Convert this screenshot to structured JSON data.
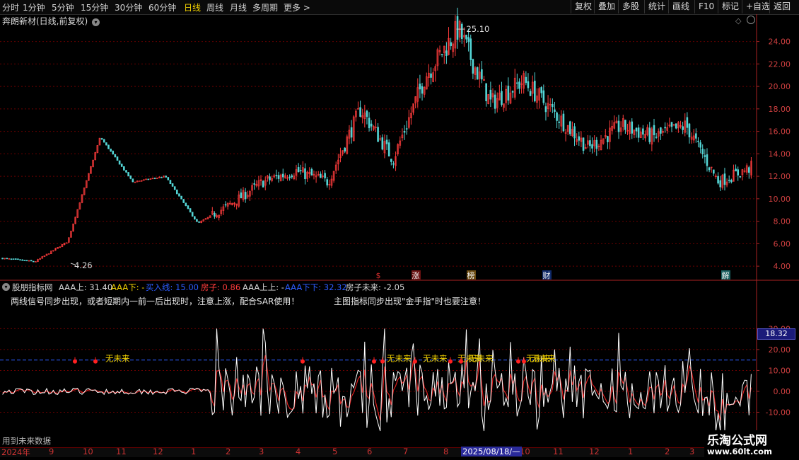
{
  "colors": {
    "up": "#ff3c3c",
    "down": "#54d6d6",
    "grid": "#6a0000",
    "axis": "#aa2222",
    "white_line": "#ffffff",
    "red_line": "#e02020",
    "yellow": "#f0d000",
    "blue": "#2c5cff"
  },
  "toolbar": {
    "periods": [
      "分时",
      "1分钟",
      "5分钟",
      "15分钟",
      "30分钟",
      "60分钟",
      "日线",
      "周线",
      "月线",
      "多周期",
      "更多 >"
    ],
    "active_period": "日线",
    "right_buttons": [
      "复权",
      "叠加",
      "多股",
      "统计",
      "画线",
      "F10",
      "标记",
      "+自选",
      "返回"
    ]
  },
  "stock": {
    "title": "奔朗新材(日线,前复权)",
    "title_icon": "chevron-down-icon",
    "high_label": "25.10",
    "low_label": "4.26"
  },
  "events": [
    "$",
    "涨",
    "榜",
    "财",
    "解"
  ],
  "indicator": {
    "name": "股朋指标网",
    "fields": [
      {
        "label": "AAA上: 31.40",
        "color": "#d8d8d8"
      },
      {
        "label": "AAA下: -",
        "color": "#f0d000"
      },
      {
        "label": "买入线: 15.00",
        "color": "#2c5cff"
      },
      {
        "label": "房子: 0.86",
        "color": "#ff3c3c"
      },
      {
        "label": "AAA上上: -",
        "color": "#d8d8d8"
      },
      {
        "label": "AAA下下: 32.32",
        "color": "#2c5cff"
      },
      {
        "label": "房子未来: -2.05",
        "color": "#d8d8d8"
      }
    ],
    "note_left": "两线信号同步出现，或者短期内一前一后出现时，注意上涨，配合SAR使用！",
    "note_right": "主图指标同步出现\"金手指\"时也要注意！",
    "future_label": "无未来",
    "crosshair_value": "18.32",
    "footer": "用到未来数据"
  },
  "axis": {
    "year": "2024年",
    "months": [
      "9",
      "10",
      "11",
      "12",
      "1",
      "2",
      "3",
      "4",
      "5",
      "6",
      "7",
      "8",
      "9",
      "10",
      "11",
      "12",
      "1",
      "2",
      "3"
    ],
    "cursor_date": "2025/08/18/—"
  },
  "watermark": {
    "title": "乐淘公式网",
    "url": "www.60lt.com"
  },
  "chart_data": [
    {
      "type": "candlestick",
      "title": "奔朗新材(日线,前复权)",
      "y_ticks": [
        4.0,
        6.0,
        8.0,
        10.0,
        12.0,
        14.0,
        16.0,
        18.0,
        20.0,
        22.0,
        24.0
      ],
      "ylim": [
        3.0,
        25.8
      ],
      "grid": true,
      "max_marker": 25.1,
      "min_marker": 4.26,
      "approx_close_path": [
        {
          "x": "2024-08",
          "y": 4.7
        },
        {
          "x": "2024-09",
          "y": 4.4
        },
        {
          "x": "2024-10",
          "y": 6.2
        },
        {
          "x": "2024-10b",
          "y": 15.5
        },
        {
          "x": "2024-11",
          "y": 11.5
        },
        {
          "x": "2024-12",
          "y": 12.0
        },
        {
          "x": "2025-01",
          "y": 7.8
        },
        {
          "x": "2025-02",
          "y": 9.5
        },
        {
          "x": "2025-03",
          "y": 11.5
        },
        {
          "x": "2025-04",
          "y": 12.5
        },
        {
          "x": "2025-05",
          "y": 11.5
        },
        {
          "x": "2025-06",
          "y": 18.0
        },
        {
          "x": "2025-06b",
          "y": 13.5
        },
        {
          "x": "2025-07",
          "y": 21.0
        },
        {
          "x": "2025-08",
          "y": 25.1
        },
        {
          "x": "2025-09",
          "y": 18.5
        },
        {
          "x": "2025-10",
          "y": 20.5
        },
        {
          "x": "2025-11",
          "y": 17.5
        },
        {
          "x": "2025-12",
          "y": 14.5
        },
        {
          "x": "2026-01",
          "y": 16.5
        },
        {
          "x": "2026-02",
          "y": 15.5
        },
        {
          "x": "2026-02b",
          "y": 16.5
        },
        {
          "x": "2026-03",
          "y": 11.5
        },
        {
          "x": "2026-03b",
          "y": 12.8
        }
      ]
    },
    {
      "type": "line",
      "title": "股朋指标网",
      "y_ticks": [
        -10.0,
        0.0,
        10.0,
        20.0,
        30.0
      ],
      "ylim": [
        -20,
        42
      ],
      "buy_line": 15.0,
      "series": [
        {
          "name": "AAA上",
          "color": "#ffffff"
        },
        {
          "name": "房子",
          "color": "#e02020"
        }
      ]
    }
  ]
}
